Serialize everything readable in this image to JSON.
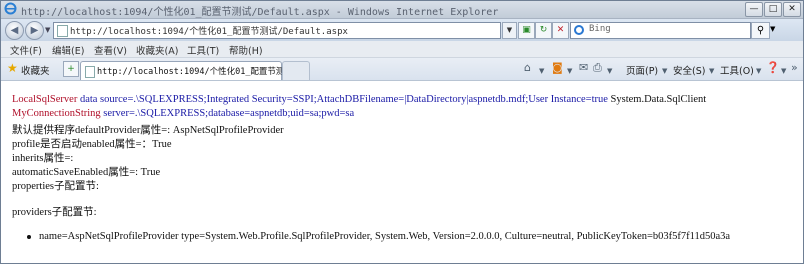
{
  "window": {
    "title": "http://localhost:1094/个性化01_配置节测试/Default.aspx - Windows Internet Explorer",
    "buttons": {
      "minimize": "—",
      "maximize": "□",
      "close": "✕"
    }
  },
  "addressbar": {
    "url": "http://localhost:1094/个性化01_配置节测试/Default.aspx",
    "search_placeholder": "Bing"
  },
  "menu": [
    "文件(F)",
    "编辑(E)",
    "查看(V)",
    "收藏夹(A)",
    "工具(T)",
    "帮助(H)"
  ],
  "tabs": {
    "favorites_label": "收藏夹",
    "active_tab": "http://localhost:1094/个性化01_配置节测试...",
    "commands": {
      "page": "页面(P)",
      "safety": "安全(S)",
      "tools": "工具(O)"
    }
  },
  "page": {
    "line1": {
      "name": "LocalSqlServer",
      "conn": " data source=.\\SQLEXPRESS;Integrated Security=SSPI;AttachDBFilename=|DataDirectory|aspnetdb.mdf;User Instance=true",
      "provider": " System.Data.SqlClient"
    },
    "line2": {
      "name": "MyConnectionString",
      "conn": " server=.\\SQLEXPRESS;database=aspnetdb;uid=sa;pwd=sa"
    },
    "line3": "默认提供程序defaultProvider属性=: AspNetSqlProfileProvider",
    "line4": "profile是否启动enabled属性=：True",
    "line5": "inherits属性=:",
    "line6": "automaticSaveEnabled属性=: True",
    "line7": "properties子配置节:",
    "line8": "providers子配置节:",
    "provider_item": "name=AspNetSqlProfileProvider type=System.Web.Profile.SqlProfileProvider, System.Web, Version=2.0.0.0, Culture=neutral, PublicKeyToken=b03f5f7f11d50a3a"
  },
  "icons": [
    "ie-icon",
    "back-icon",
    "forward-icon",
    "page-icon",
    "refresh-icon",
    "stop-icon",
    "bing-icon",
    "search-icon",
    "favorites-star-icon",
    "add-favorites-icon",
    "home-icon",
    "feeds-icon",
    "mail-icon",
    "print-icon",
    "help-icon"
  ],
  "colors": {
    "connection_name": "#b0102a",
    "connection_value": "#1a1aa6"
  }
}
